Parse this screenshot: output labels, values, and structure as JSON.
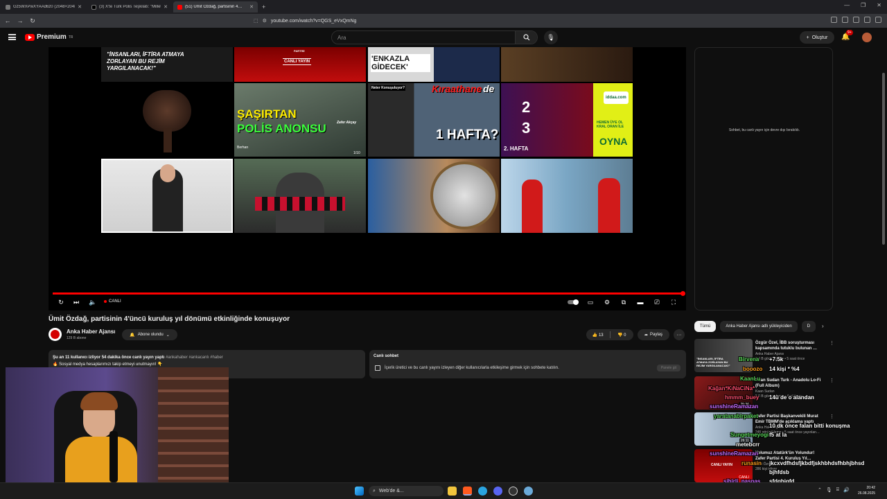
{
  "browser": {
    "tabs": [
      {
        "title": "Gz5WXPwXYAAd6z0 (2048×2048)",
        "active": false
      },
      {
        "title": "(3) X'te Türk Polis Teşkilatı: \"Milletimi…",
        "active": false
      },
      {
        "title": "(51) Ümit Özdağ, partisinin 4…",
        "active": true
      }
    ],
    "new_tab_label": "+",
    "url": "youtube.com/watch?v=QGS_eVxQmNg"
  },
  "yt_header": {
    "logo_text": "Premium",
    "logo_sup": "TR",
    "search_placeholder": "Ara",
    "create_label": "Oluştur",
    "notif_count": "9+"
  },
  "player": {
    "live_label": "CANLI",
    "thumbs": [
      {
        "text": "\"İNSANLARI, İFTİRA ATMAYA ZORLAYAN BU REJİM YARGILANACAK!\""
      },
      {
        "text": "CANLI YAYIN",
        "sub": "PARTİSİ"
      },
      {
        "text": "'ENKAZLA GİDECEK'"
      },
      {
        "text": "ŞAŞIRTAN",
        "text2": "POLİS ANONSU",
        "name": "Zafer Akçay",
        "pager": "1/10",
        "author": "Berhan"
      },
      {
        "text": "Neter Konuşuluyor?",
        "text2": "Kıraathane",
        "text3": "de",
        "text4": "1 HAFTA?"
      },
      {
        "text": "2",
        "text2": "3",
        "text3": "2. HAFTA",
        "text4": "iddaa.com",
        "text5": "HEMEN ÜYE OL KRAL ORAN İLE",
        "text6": "OYNA"
      }
    ]
  },
  "chat_panel": {
    "message": "Sohbet, bu canlı yayın için devre dışı bırakıldı."
  },
  "video": {
    "title": "Ümit Özdağ, partisinin 4'üncü kuruluş yıl dönümü etkinliğinde konuşuyor",
    "channel": "Anka Haber Ajansı",
    "subscribers": "129 B abone",
    "subscribed_label": "Abone olundu",
    "likes": "13",
    "dislikes": "0",
    "share_label": "Paylaş",
    "more_label": "···"
  },
  "description": {
    "line1": "Şu an 11 kullanıcı izliyor  54 dakika önce canlı yayın yaptı",
    "tags": "#ankahaber #ankacanlı #haber",
    "line2": "🔥 Sosyal medya hesaplarımızı takip etmeyi unutmayın! 👇"
  },
  "live_chat": {
    "heading": "Canlı sohbet",
    "text": "İçerik üretici ve bu canlı yayını izleyen diğer kullanıcılarla etkileşime girmek için sohbete katılın.",
    "button": "Panele git"
  },
  "chips": [
    "Tümü",
    "Anka Haber Ajansı adlı yükleyiciden",
    "D"
  ],
  "recommendations": [
    {
      "title": "Özgür Özel, İBB soruşturması kapsamında tutuklu bulunan …",
      "channel": "Anka Haber Ajansı",
      "meta": "3,4 B görüntüleme • 5 saat önce",
      "duration": "",
      "thumb_text": "\"İNSANLARI, İFTİRA ATMAYA ZORLAYAN BU REJİM YARGILANACAK!\""
    },
    {
      "title": "Kaan Sudan Turk - Anadolu Lo-Fi (Full Album)",
      "channel": "Kaan Sudan",
      "meta": "5,8 B görüntüleme • 4 yıl önce",
      "duration": "25:36",
      "thumb_text": ""
    },
    {
      "title": "Zafer Partisi Başkanvekili Murat Emir TBMM'de açıklama yaptı",
      "channel": "Anka Haber Ajansı",
      "meta": "245 görüntüleme • 5 saat önce yayınlan…",
      "duration": "26:11",
      "thumb_text": ""
    },
    {
      "title": "Yolumuz Atatürk'ün Yolundur! Zafer Partisi 4. Kuruluş Yıl…",
      "channel": "Ümit Özdağ - Zafer Partisi Genel Başkanı",
      "meta": "286 kişi izliyor",
      "duration": "CANLI",
      "thumb_text": "CANLI YAYIN"
    }
  ],
  "overlay_chat": [
    {
      "user": "Birvena",
      "msg": "+7.5k"
    },
    {
      "user": "booozo",
      "msg": "14 kişi * %4"
    },
    {
      "user": "KaanLu",
      "msg": ""
    },
    {
      "user": "Kağan*KıNaCiNa*",
      "msg": ""
    },
    {
      "user": "hmmm_buey",
      "msg": "14ü de o alandan"
    },
    {
      "user": "sunshineRamazan",
      "msg": ""
    },
    {
      "user": "yaratanabirpaket",
      "msg": "10 dk önce falan bitti konuşma"
    },
    {
      "user": "Sungetmeyogic",
      "msg": "f5 at la"
    },
    {
      "user": "",
      "msg": "metebcrr"
    },
    {
      "user": "sunshineRamazan",
      "msg": ""
    },
    {
      "user": "runasin",
      "msg": "jkcxvdfhdsfjkbdfjskhbhdsfhbhjbhsd"
    },
    {
      "user": "",
      "msg": "bjhfdsb"
    },
    {
      "user": "sihirli_paspas",
      "msg": "sfdghjgfd"
    },
    {
      "user": "jaksebar",
      "msg": ""
    }
  ],
  "taskbar": {
    "search_label": "Web'de &...",
    "time": "20:42",
    "date": "26.08.2025"
  },
  "colors": {
    "accent_red": "#ff0000",
    "bg": "#0f0f0f",
    "surface": "#272727"
  }
}
